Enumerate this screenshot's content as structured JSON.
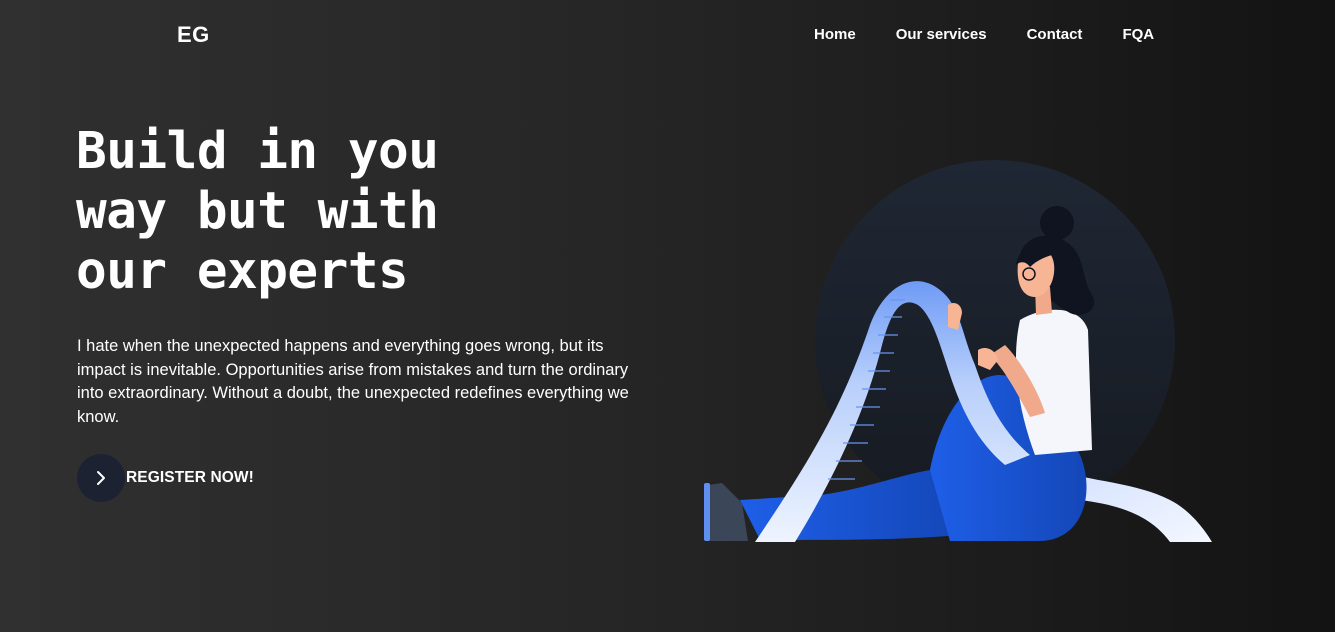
{
  "header": {
    "logo": "EG",
    "nav": [
      "Home",
      "Our services",
      "Contact",
      "FQA"
    ]
  },
  "hero": {
    "headline_lines": [
      "Build in you",
      "way but with",
      "our experts"
    ],
    "description": "I hate when the unexpected happens and everything goes wrong, but its impact is inevitable. Opportunities arise from mistakes and turn the ordinary into extraordinary. Without a doubt, the unexpected redefines everything we know.",
    "cta_label": "REGISTER NOW!"
  },
  "icons": {
    "cta": "chevron-right-icon"
  },
  "colors": {
    "accent_blue": "#1e5fe8",
    "paper_blue": "#dbe7ff",
    "circle_bg": "#1d2233"
  }
}
